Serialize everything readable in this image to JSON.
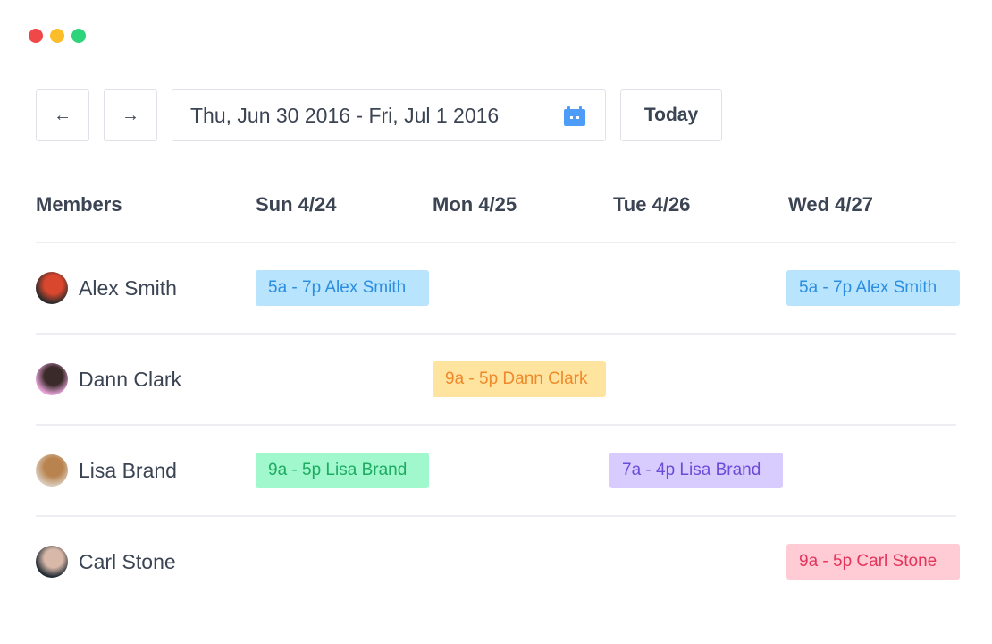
{
  "window": {
    "controls": [
      {
        "name": "close",
        "color": "#f04848"
      },
      {
        "name": "minimize",
        "color": "#fbbd2a"
      },
      {
        "name": "maximize",
        "color": "#2ed47a"
      }
    ]
  },
  "toolbar": {
    "prev_icon": "←",
    "next_icon": "→",
    "date_range": "Thu, Jun 30 2016 - Fri, Jul 1 2016",
    "calendar_icon": "calendar-icon",
    "calendar_icon_color": "#4d9cf8",
    "today_label": "Today"
  },
  "table": {
    "headers": [
      "Members",
      "Sun 4/24",
      "Mon 4/25",
      "Tue 4/26",
      "Wed 4/27"
    ],
    "members": [
      {
        "name": "Alex Smith",
        "avatar_colors": [
          "#2b2b2b",
          "#d9472e"
        ]
      },
      {
        "name": "Dann Clark",
        "avatar_colors": [
          "#e7a3d7",
          "#3a2a2a"
        ]
      },
      {
        "name": "Lisa Brand",
        "avatar_colors": [
          "#d8c9b8",
          "#b9834f"
        ]
      },
      {
        "name": "Carl Stone",
        "avatar_colors": [
          "#1f2a33",
          "#d8b8a8"
        ]
      }
    ],
    "shifts": [
      {
        "member": 0,
        "day": 0,
        "label": "5a - 7p Alex Smith",
        "bg": "#b8e4fd",
        "fg": "#2d8ee0"
      },
      {
        "member": 0,
        "day": 3,
        "label": "5a - 7p Alex Smith",
        "bg": "#b8e4fd",
        "fg": "#2d8ee0"
      },
      {
        "member": 1,
        "day": 1,
        "label": "9a - 5p Dann Clark",
        "bg": "#ffe4a0",
        "fg": "#ef8a2a"
      },
      {
        "member": 2,
        "day": 0,
        "label": "9a - 5p Lisa Brand",
        "bg": "#a0f8cc",
        "fg": "#1eab62"
      },
      {
        "member": 2,
        "day": 2,
        "label": "7a - 4p Lisa Brand",
        "bg": "#d7ccfd",
        "fg": "#6d4bd9"
      },
      {
        "member": 3,
        "day": 3,
        "label": "9a - 5p Carl Stone",
        "bg": "#ffccd6",
        "fg": "#e4345a"
      }
    ]
  }
}
